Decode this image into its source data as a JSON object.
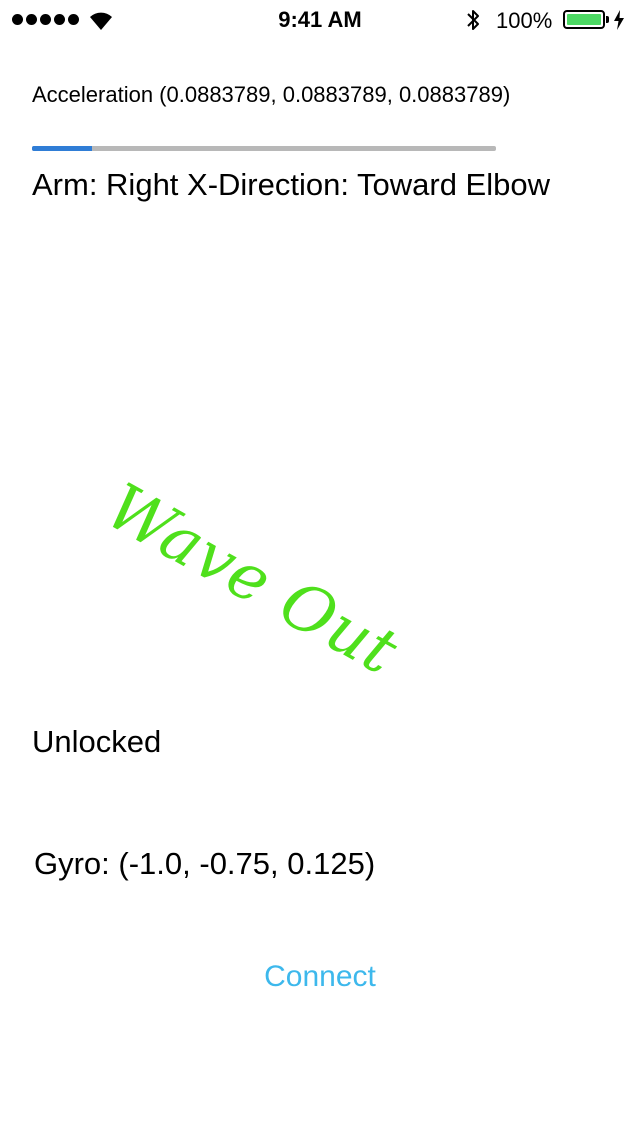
{
  "status_bar": {
    "time": "9:41 AM",
    "battery_percent": "100%",
    "battery_level": 1.0,
    "signal_bars": 5,
    "battery_color": "#4cd964",
    "icons": [
      "signal-dots-icon",
      "wifi-icon",
      "bluetooth-icon",
      "battery-icon",
      "charging-bolt-icon"
    ]
  },
  "sensors": {
    "acceleration_text": "Acceleration (0.0883789, 0.0883789, 0.0883789)",
    "progress_fraction": 0.13,
    "progress_color": "#2f7dd6",
    "arm_direction_text": "Arm: Right X-Direction: Toward Elbow",
    "gesture": "Wave Out",
    "gesture_color": "#4fe01c",
    "lock_status": "Unlocked",
    "gyro_text": "Gyro: (-1.0, -0.75, 0.125)"
  },
  "actions": {
    "connect_label": "Connect",
    "connect_color": "#3db8ec"
  }
}
